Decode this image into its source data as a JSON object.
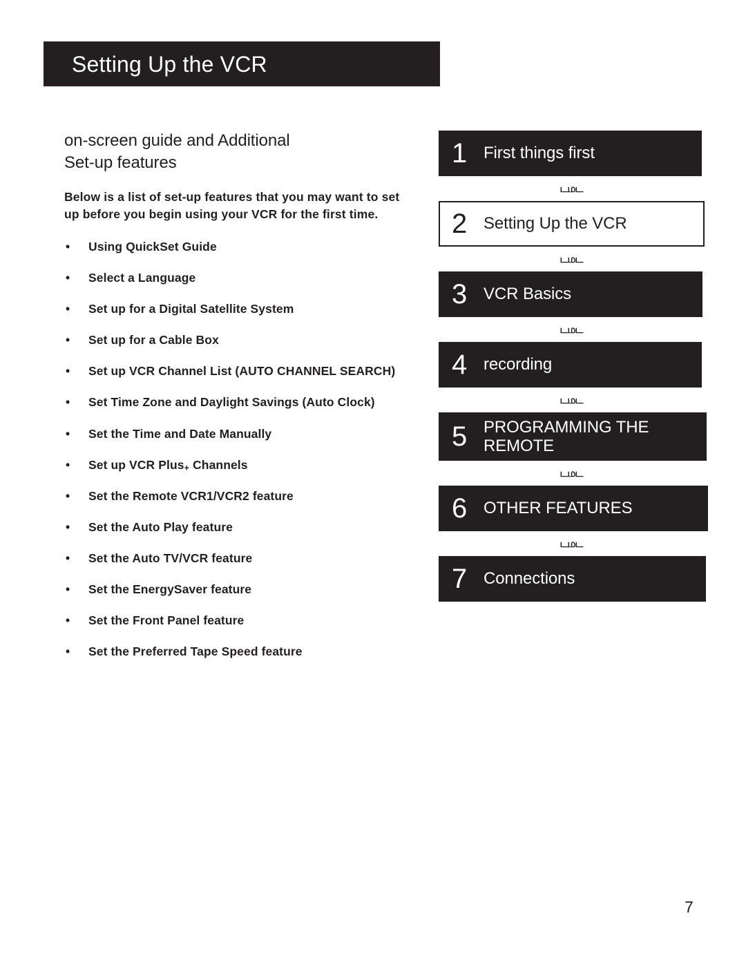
{
  "header": {
    "title": "Setting Up the VCR"
  },
  "left": {
    "subtitle_line1": "on-screen guide and Additional",
    "subtitle_line2": "Set-up features",
    "intro": "Below is a list of set-up features that you may want to set up before you begin using your VCR for the first time.",
    "bullet_glyph": "•",
    "features": [
      {
        "text": "Using QuickSet Guide"
      },
      {
        "text": "Select a Language"
      },
      {
        "text": "Set up for a Digital Satellite System"
      },
      {
        "text": "Set up for a Cable Box"
      },
      {
        "text": "Set up VCR Channel List (AUTO CHANNEL SEARCH)"
      },
      {
        "text": "Set Time Zone and Daylight Savings (Auto Clock)"
      },
      {
        "text": "Set the Time and Date Manually"
      },
      {
        "text": "Set up VCR Plus+ Channels",
        "has_subscript_plus": true,
        "base": "Set up VCR Plus",
        "sub": "+",
        "tail": " Channels"
      },
      {
        "text": "Set the Remote VCR1/VCR2 feature"
      },
      {
        "text": "Set the Auto Play feature"
      },
      {
        "text": "Set the Auto TV/VCR feature"
      },
      {
        "text": "Set the EnergySaver feature"
      },
      {
        "text": "Set the Front Panel feature"
      },
      {
        "text": "Set the Preferred Tape Speed feature"
      }
    ]
  },
  "right": {
    "separator_glyph": "டமட",
    "chapters": [
      {
        "number": "1",
        "label": "First things first",
        "style": "dark"
      },
      {
        "number": "2",
        "label": "Setting Up the VCR",
        "style": "light"
      },
      {
        "number": "3",
        "label": "VCR Basics",
        "style": "dark"
      },
      {
        "number": "4",
        "label": "recording",
        "style": "dark"
      },
      {
        "number": "5",
        "label": "PROGRAMMING THE\nREMOTE",
        "style": "dark"
      },
      {
        "number": "6",
        "label": "OTHER FEATURES",
        "style": "dark"
      },
      {
        "number": "7",
        "label": "Connections",
        "style": "dark"
      }
    ]
  },
  "footer": {
    "page_number": "7"
  },
  "colors": {
    "ink": "#231f20",
    "paper": "#ffffff"
  }
}
